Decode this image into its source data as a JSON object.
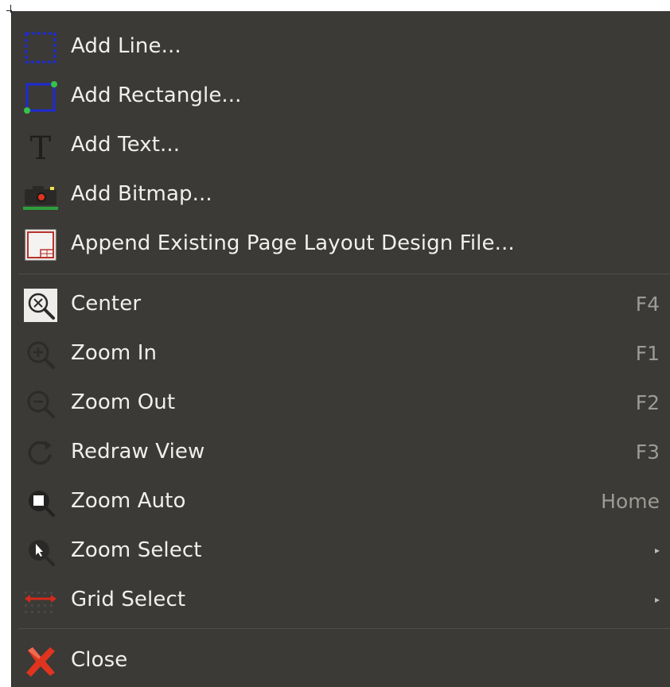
{
  "menu": {
    "items": [
      {
        "id": "add-line",
        "label": "Add Line...",
        "shortcut": "",
        "icon": "add-line-icon"
      },
      {
        "id": "add-rectangle",
        "label": "Add Rectangle...",
        "shortcut": "",
        "icon": "add-rectangle-icon"
      },
      {
        "id": "add-text",
        "label": "Add Text...",
        "shortcut": "",
        "icon": "add-text-icon"
      },
      {
        "id": "add-bitmap",
        "label": "Add Bitmap...",
        "shortcut": "",
        "icon": "add-bitmap-icon"
      },
      {
        "id": "append-layout",
        "label": "Append Existing Page Layout Design File...",
        "shortcut": "",
        "icon": "page-layout-file-icon"
      },
      {
        "id": "center",
        "label": "Center",
        "shortcut": "F4",
        "icon": "center-icon"
      },
      {
        "id": "zoom-in",
        "label": "Zoom In",
        "shortcut": "F1",
        "icon": "zoom-in-icon"
      },
      {
        "id": "zoom-out",
        "label": "Zoom Out",
        "shortcut": "F2",
        "icon": "zoom-out-icon"
      },
      {
        "id": "redraw-view",
        "label": "Redraw View",
        "shortcut": "F3",
        "icon": "redraw-icon"
      },
      {
        "id": "zoom-auto",
        "label": "Zoom Auto",
        "shortcut": "Home",
        "icon": "zoom-auto-icon"
      },
      {
        "id": "zoom-select",
        "label": "Zoom Select",
        "shortcut": "",
        "submenu_arrow": "▸",
        "icon": "zoom-select-icon"
      },
      {
        "id": "grid-select",
        "label": "Grid Select",
        "shortcut": "",
        "submenu_arrow": "▸",
        "icon": "grid-select-icon"
      },
      {
        "id": "close",
        "label": "Close",
        "shortcut": "",
        "icon": "close-icon"
      }
    ]
  },
  "colors": {
    "menu_bg": "#3b3a37",
    "text": "#f0efed",
    "shortcut_text": "#9d9b96",
    "accent_blue": "#1e2bd6",
    "accent_green": "#37c24a",
    "accent_red": "#e0341e"
  }
}
